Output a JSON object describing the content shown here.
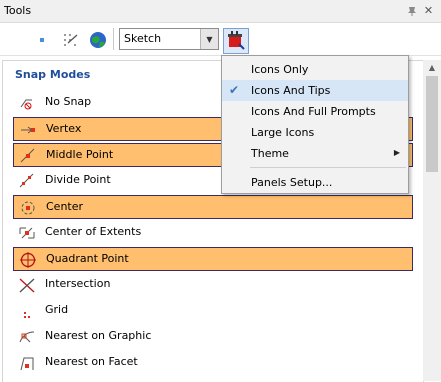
{
  "window": {
    "title": "Tools"
  },
  "toolbar": {
    "workflow_value": "Sketch",
    "icons": [
      "dot-icon",
      "snap-grid-icon",
      "globe-icon",
      "palette-icon"
    ]
  },
  "panel": {
    "section_title": "Snap Modes",
    "items": [
      {
        "label": "No Snap",
        "icon": "no-snap-icon",
        "selected": false
      },
      {
        "label": "Vertex",
        "icon": "vertex-icon",
        "selected": true
      },
      {
        "label": "Middle Point",
        "icon": "middle-point-icon",
        "selected": true
      },
      {
        "label": "Divide Point",
        "icon": "divide-point-icon",
        "selected": false
      },
      {
        "label": "Center",
        "icon": "center-icon",
        "selected": true
      },
      {
        "label": "Center of Extents",
        "icon": "center-of-extents-icon",
        "selected": false
      },
      {
        "label": "Quadrant Point",
        "icon": "quadrant-point-icon",
        "selected": true
      },
      {
        "label": "Intersection",
        "icon": "intersection-icon",
        "selected": false
      },
      {
        "label": "Grid",
        "icon": "grid-icon",
        "selected": false
      },
      {
        "label": "Nearest on Graphic",
        "icon": "nearest-on-graphic-icon",
        "selected": false
      },
      {
        "label": "Nearest on Facet",
        "icon": "nearest-on-facet-icon",
        "selected": false
      }
    ]
  },
  "context_menu": {
    "items": [
      {
        "label": "Icons Only",
        "checked": false
      },
      {
        "label": "Icons And Tips",
        "checked": true
      },
      {
        "label": "Icons And Full Prompts",
        "checked": false
      },
      {
        "label": "Large Icons",
        "checked": false
      },
      {
        "label": "Theme",
        "checked": false,
        "submenu": true
      },
      {
        "label": "Panels Setup...",
        "checked": false
      }
    ]
  },
  "colors": {
    "selected_row_bg": "#ffbf6e",
    "selected_row_border": "#3a2b66",
    "section_title": "#1f4e9b",
    "menu_check": "#3a74b8"
  }
}
